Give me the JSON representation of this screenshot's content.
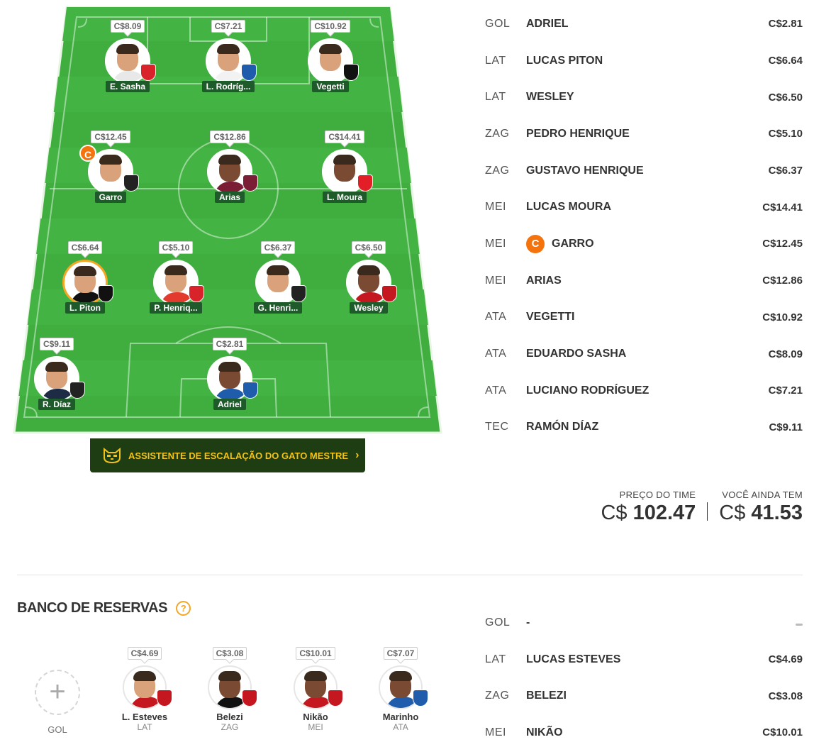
{
  "field": {
    "players": [
      {
        "id": "sasha",
        "name": "E. Sasha",
        "price": "C$8.09",
        "face": "light",
        "shirt": "#e8e8e8",
        "crest": "#d8232a",
        "captain": false,
        "gold": false
      },
      {
        "id": "rodriguez",
        "name": "L. Rodríg...",
        "price": "C$7.21",
        "face": "light",
        "shirt": "#f2f2f2",
        "crest": "#1f5cab",
        "captain": false,
        "gold": false
      },
      {
        "id": "vegetti",
        "name": "Vegetti",
        "price": "C$10.92",
        "face": "light",
        "shirt": "#ffffff",
        "crest": "#111111",
        "captain": false,
        "gold": false
      },
      {
        "id": "garro",
        "name": "Garro",
        "price": "C$12.45",
        "face": "light",
        "shirt": "#ffffff",
        "crest": "#222222",
        "captain": true,
        "gold": false
      },
      {
        "id": "arias",
        "name": "Arias",
        "price": "C$12.86",
        "face": "dark",
        "shirt": "#7b1d35",
        "crest": "#7b1d35",
        "captain": false,
        "gold": false
      },
      {
        "id": "moura",
        "name": "L. Moura",
        "price": "C$14.41",
        "face": "dark",
        "shirt": "#ffffff",
        "crest": "#e21f26",
        "captain": false,
        "gold": false
      },
      {
        "id": "piton",
        "name": "L. Piton",
        "price": "C$6.64",
        "face": "light",
        "shirt": "#111111",
        "crest": "#111111",
        "captain": false,
        "gold": true
      },
      {
        "id": "henrique",
        "name": "P. Henriq...",
        "price": "C$5.10",
        "face": "light",
        "shirt": "#e33a2e",
        "crest": "#d8232a",
        "captain": false,
        "gold": false
      },
      {
        "id": "gustavo",
        "name": "G. Henri...",
        "price": "C$6.37",
        "face": "light",
        "shirt": "#ffffff",
        "crest": "#222222",
        "captain": false,
        "gold": false
      },
      {
        "id": "wesley",
        "name": "Wesley",
        "price": "C$6.50",
        "face": "dark",
        "shirt": "#c4171f",
        "crest": "#c4171f",
        "captain": false,
        "gold": false
      },
      {
        "id": "diaz",
        "name": "R. Díaz",
        "price": "C$9.11",
        "face": "light",
        "shirt": "#1d2b45",
        "crest": "#222222",
        "captain": false,
        "gold": false
      },
      {
        "id": "adriel",
        "name": "Adriel",
        "price": "C$2.81",
        "face": "dark",
        "shirt": "#1f5cab",
        "crest": "#1f5cab",
        "captain": false,
        "gold": false
      }
    ],
    "captain_letter": "C"
  },
  "assistant": {
    "label": "ASSISTENTE DE ESCALAÇÃO DO GATO MESTRE",
    "chevron": "›"
  },
  "lineup": [
    {
      "pos": "GOL",
      "name": "ADRIEL",
      "price": "C$2.81",
      "captain": false
    },
    {
      "pos": "LAT",
      "name": "LUCAS PITON",
      "price": "C$6.64",
      "captain": false
    },
    {
      "pos": "LAT",
      "name": "WESLEY",
      "price": "C$6.50",
      "captain": false
    },
    {
      "pos": "ZAG",
      "name": "PEDRO HENRIQUE",
      "price": "C$5.10",
      "captain": false
    },
    {
      "pos": "ZAG",
      "name": "GUSTAVO HENRIQUE",
      "price": "C$6.37",
      "captain": false
    },
    {
      "pos": "MEI",
      "name": "LUCAS MOURA",
      "price": "C$14.41",
      "captain": false
    },
    {
      "pos": "MEI",
      "name": "GARRO",
      "price": "C$12.45",
      "captain": true
    },
    {
      "pos": "MEI",
      "name": "ARIAS",
      "price": "C$12.86",
      "captain": false
    },
    {
      "pos": "ATA",
      "name": "VEGETTI",
      "price": "C$10.92",
      "captain": false
    },
    {
      "pos": "ATA",
      "name": "EDUARDO SASHA",
      "price": "C$8.09",
      "captain": false
    },
    {
      "pos": "ATA",
      "name": "LUCIANO RODRÍGUEZ",
      "price": "C$7.21",
      "captain": false
    },
    {
      "pos": "TEC",
      "name": "RAMÓN DÍAZ",
      "price": "C$9.11",
      "captain": false
    }
  ],
  "totals": {
    "team_price_label": "PREÇO DO TIME",
    "team_price_currency": "C$",
    "team_price_value": "102.47",
    "balance_label": "VOCÊ AINDA TEM",
    "balance_currency": "C$",
    "balance_value": "41.53"
  },
  "bench": {
    "title": "BANCO DE RESERVAS",
    "help": "?",
    "empty_slot": {
      "icon": "+",
      "pos": "GOL"
    },
    "players": [
      {
        "name": "L. Esteves",
        "pos": "LAT",
        "price": "C$4.69",
        "face": "light",
        "shirt": "#c4171f",
        "crest": "#c4171f"
      },
      {
        "name": "Belezi",
        "pos": "ZAG",
        "price": "C$3.08",
        "face": "dark",
        "shirt": "#111111",
        "crest": "#c4171f"
      },
      {
        "name": "Nikão",
        "pos": "MEI",
        "price": "C$10.01",
        "face": "dark",
        "shirt": "#c4171f",
        "crest": "#c4171f"
      },
      {
        "name": "Marinho",
        "pos": "ATA",
        "price": "C$7.07",
        "face": "dark",
        "shirt": "#1f5cab",
        "crest": "#1f5cab"
      }
    ],
    "list": [
      {
        "pos": "GOL",
        "name": "-",
        "price": ""
      },
      {
        "pos": "LAT",
        "name": "LUCAS ESTEVES",
        "price": "C$4.69"
      },
      {
        "pos": "ZAG",
        "name": "BELEZI",
        "price": "C$3.08"
      },
      {
        "pos": "MEI",
        "name": "NIKÃO",
        "price": "C$10.01"
      }
    ]
  }
}
